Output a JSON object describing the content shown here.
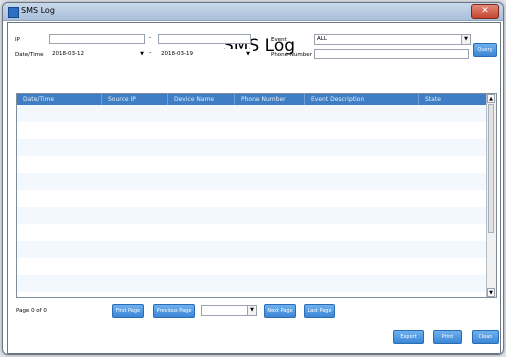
{
  "window": {
    "title": "SMS Log",
    "close_label": "✕"
  },
  "heading": "SMS Log",
  "filters": {
    "ip_label": "IP",
    "ip_from": "",
    "ip_to": "",
    "ip_sep": "-",
    "datetime_label": "Date/Time",
    "date_from": "2018-03-12",
    "date_to": "2018-03-19",
    "date_sep": "-",
    "event_label": "Event",
    "event_value": "ALL",
    "phone_label": "Phone Number",
    "phone_value": ""
  },
  "buttons": {
    "query": "Query",
    "first_page": "First Page",
    "previous_page": "Previous Page",
    "next_page": "Next Page",
    "last_page": "Last Page",
    "export": "Export",
    "print": "Print",
    "clean": "Clean"
  },
  "table": {
    "columns": [
      "Date/Time",
      "Source IP",
      "Device Name",
      "Phone Number",
      "Event Description",
      "State"
    ],
    "row_count": 11
  },
  "pagination": {
    "page_info": "Page 0 of 0",
    "page_select": ""
  },
  "colors": {
    "header": "#3f7ec4",
    "button": "#3b86d6",
    "alt_row": "#f2f8fd"
  },
  "icons": [
    "app-icon",
    "close-icon",
    "dropdown-arrow-icon",
    "scroll-up-icon",
    "scroll-down-icon"
  ]
}
